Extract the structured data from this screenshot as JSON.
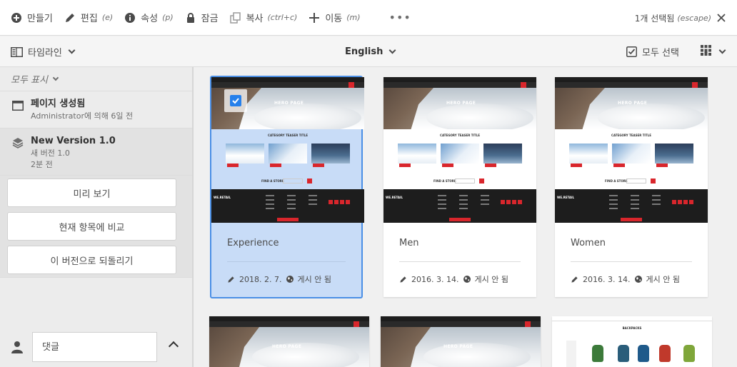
{
  "toolbar": {
    "create": "만들기",
    "edit": "편집",
    "edit_shortcut": "(e)",
    "properties": "속성",
    "properties_shortcut": "(p)",
    "lock": "잠금",
    "copy": "복사",
    "copy_shortcut": "(ctrl+c)",
    "move": "이동",
    "move_shortcut": "(m)",
    "more": "•••",
    "selection": "1개 선택됨",
    "selection_shortcut": "(escape)"
  },
  "subbar": {
    "timeline": "타임라인",
    "language": "English",
    "select_all": "모두 선택"
  },
  "rail": {
    "filter": "모두 표시",
    "entries": [
      {
        "title": "페이지 생성됨",
        "subtitle": "Administrator에 의해 6일 전"
      },
      {
        "title": "New Version 1.0",
        "subtitle": "새 버전 1.0",
        "time": "2분 전"
      }
    ],
    "buttons": {
      "preview": "미리 보기",
      "compare": "현재 항목에 비교",
      "revert": "이 버전으로 되돌리기"
    },
    "comment_placeholder": "댓글"
  },
  "cards": [
    {
      "title": "Experience",
      "date": "2018. 2. 7.",
      "status": "게시 안 됨",
      "selected": true
    },
    {
      "title": "Men",
      "date": "2016. 3. 14.",
      "status": "게시 안 됨",
      "selected": false
    },
    {
      "title": "Women",
      "date": "2016. 3. 14.",
      "status": "게시 안 됨",
      "selected": false
    }
  ],
  "thumb_text": {
    "hero": "HERO PAGE",
    "category": "CATEGORY TEASER TITLE",
    "find": "FIND A STORE",
    "brand": "WE.RETAIL",
    "backpacks": "BACKPACKS"
  },
  "colors": {
    "accent": "#2680eb",
    "selected_bg": "#c8dcf7",
    "selected_border": "#4a8fe6",
    "brand_red": "#d9262c"
  }
}
